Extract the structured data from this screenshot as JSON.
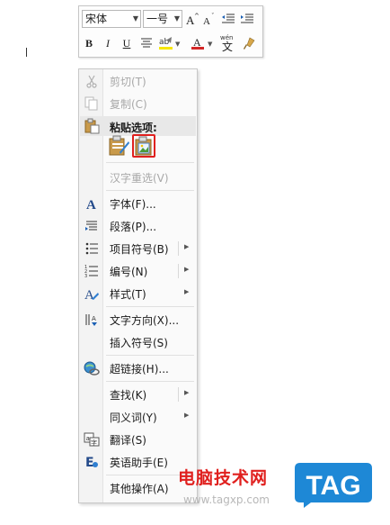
{
  "mini_toolbar": {
    "font_name": "宋体",
    "font_size": "一号",
    "bold": "B",
    "italic": "I",
    "underline": "U",
    "font_color_letter": "A"
  },
  "context_menu": {
    "items": [
      {
        "label": "剪切(T)",
        "icon": "scissors-icon",
        "enabled": false
      },
      {
        "label": "复制(C)",
        "icon": "copy-icon",
        "enabled": false
      },
      {
        "label": "粘贴选项:",
        "icon": "paste-icon",
        "enabled": true
      },
      {
        "label": "汉字重选(V)",
        "enabled": false
      },
      {
        "label": "字体(F)...",
        "icon": "font-icon",
        "enabled": true
      },
      {
        "label": "段落(P)...",
        "icon": "paragraph-icon",
        "enabled": true
      },
      {
        "label": "项目符号(B)",
        "icon": "bullets-icon",
        "enabled": true,
        "submenu": true
      },
      {
        "label": "编号(N)",
        "icon": "numbering-icon",
        "enabled": true,
        "submenu": true
      },
      {
        "label": "样式(T)",
        "icon": "styles-icon",
        "enabled": true,
        "submenu": true
      },
      {
        "label": "文字方向(X)...",
        "icon": "text-direction-icon",
        "enabled": true
      },
      {
        "label": "插入符号(S)",
        "enabled": true
      },
      {
        "label": "超链接(H)...",
        "icon": "hyperlink-icon",
        "enabled": true
      },
      {
        "label": "查找(K)",
        "enabled": true,
        "submenu": true
      },
      {
        "label": "同义词(Y)",
        "enabled": true,
        "submenu": true
      },
      {
        "label": "翻译(S)",
        "icon": "translate-icon",
        "enabled": true
      },
      {
        "label": "英语助手(E)",
        "icon": "english-assistant-icon",
        "enabled": true
      },
      {
        "label": "其他操作(A)",
        "enabled": true,
        "submenu": true
      }
    ],
    "paste_options": [
      {
        "icon": "keep-source-formatting-icon"
      },
      {
        "icon": "paste-as-picture-icon",
        "highlighted": true,
        "highlight_color": "#e0201e"
      }
    ]
  },
  "watermark": {
    "text": "电脑技术网",
    "url": "www.tagxp.com",
    "logo": "TAG",
    "color": "#e0201e",
    "logo_color": "#1e88d6"
  }
}
